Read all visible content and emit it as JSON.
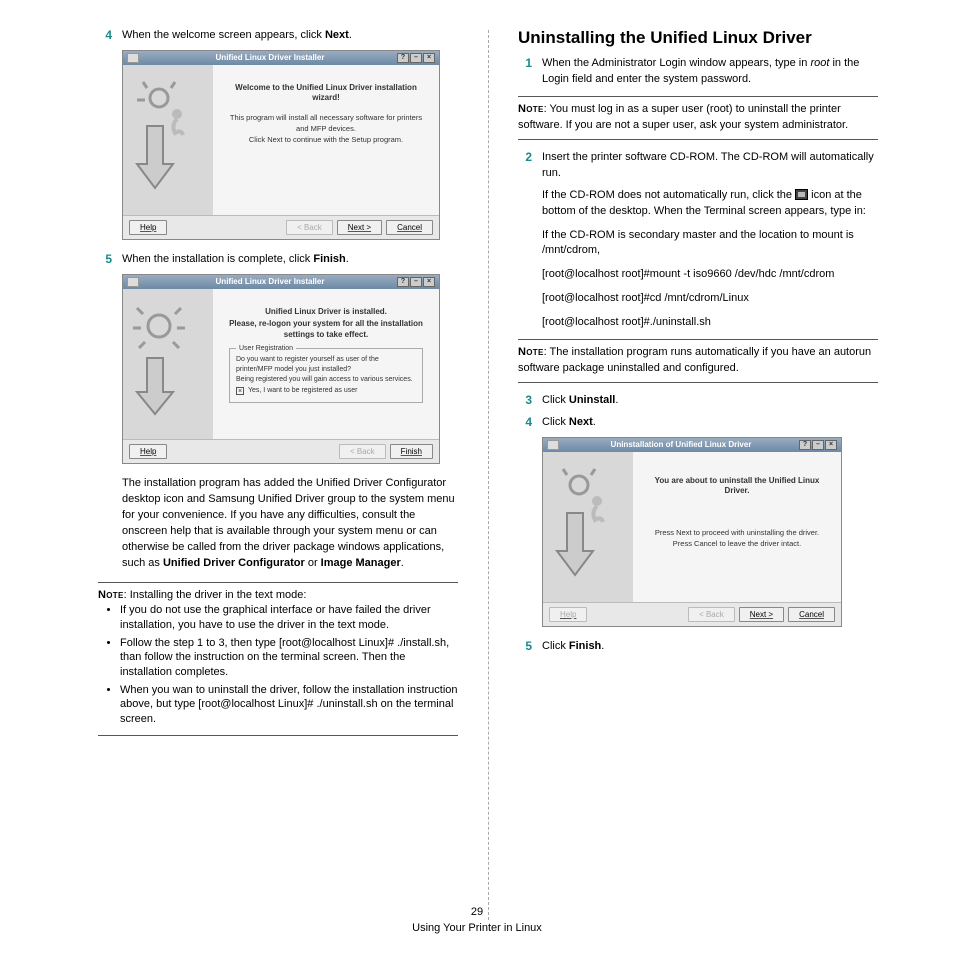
{
  "left": {
    "step4_num": "4",
    "step4_text_a": "When the welcome screen appears, click ",
    "step4_bold": "Next",
    "step4_text_b": ".",
    "step5_num": "5",
    "step5_text_a": "When the installation is complete, click ",
    "step5_bold": "Finish",
    "step5_text_b": ".",
    "para_a": "The installation program has added the Unified Driver Configurator desktop icon and Samsung Unified Driver group to the system menu for your convenience. If you have any difficulties, consult the onscreen help that is available through your system menu or can otherwise be called from the driver package windows applications, such as ",
    "para_b1": "Unified Driver Configurator",
    "para_mid": " or ",
    "para_b2": "Image Manager",
    "para_end": ".",
    "note_label": "Note",
    "note_intro": ": Installing the driver in the text mode:",
    "b1": "If you do not use the graphical interface or have failed the driver installation, you have to use the driver in the text mode.",
    "b2": "Follow the step 1 to 3, then type [root@localhost Linux]# ./install.sh, than follow the instruction on the terminal screen. Then the installation completes.",
    "b3": "When you wan to uninstall the driver, follow the installation instruction above, but type [root@localhost Linux]# ./uninstall.sh on the terminal screen.",
    "mock1": {
      "title": "Unified Linux Driver Installer",
      "h1": "Welcome to the Unified Linux Driver installation wizard!",
      "l1": "This program will install all necessary software for printers and MFP devices.",
      "l2": "Click Next to continue with the Setup program.",
      "help": "Help",
      "back": "< Back",
      "next": "Next >",
      "cancel": "Cancel"
    },
    "mock2": {
      "title": "Unified Linux Driver Installer",
      "h1": "Unified Linux Driver is installed.",
      "h2": "Please, re-logon your system for all the installation settings to take effect.",
      "legend": "User Registration",
      "reg_q": "Do you want to register yourself as user of the printer/MFP model you just installed?",
      "reg_r": "Being registered you will gain access to various services.",
      "cb": "Yes, I want to be registered as user",
      "help": "Help",
      "back": "< Back",
      "finish": "Finish"
    }
  },
  "right": {
    "heading": "Uninstalling the Unified Linux Driver",
    "s1_num": "1",
    "s1_a": "When the Administrator Login window appears, type in ",
    "s1_i": "root",
    "s1_b": " in the Login field and enter the system password.",
    "note1_label": "Note",
    "note1_text": ": You must log in as a super user (root) to uninstall the printer software. If you are not a super user, ask your system administrator.",
    "s2_num": "2",
    "s2_text": "Insert the printer software CD-ROM. The CD-ROM will automatically run.",
    "i1a": "If the CD-ROM does not automatically run, click the ",
    "i1b": " icon at the bottom of the desktop. When the Terminal screen appears, type in:",
    "i2": "If the CD-ROM is secondary master and the location to mount is /mnt/cdrom,",
    "i3": "[root@localhost root]#mount -t iso9660 /dev/hdc /mnt/cdrom",
    "i4": "[root@localhost root]#cd /mnt/cdrom/Linux",
    "i5": "[root@localhost root]#./uninstall.sh",
    "note2_label": "Note",
    "note2_text": ": The installation program runs automatically if you have an autorun software package uninstalled and configured.",
    "s3_num": "3",
    "s3_a": "Click ",
    "s3_b": "Uninstall",
    "s3_c": ".",
    "s4_num": "4",
    "s4_a": "Click ",
    "s4_b": "Next",
    "s4_c": ".",
    "s5_num": "5",
    "s5_a": "Click ",
    "s5_b": "Finish",
    "s5_c": ".",
    "mock": {
      "title": "Uninstallation of Unified Linux Driver",
      "h1": "You are about to uninstall the Unified Linux Driver.",
      "l1": "Press Next to proceed with uninstalling the driver.",
      "l2": "Press Cancel to leave the driver intact.",
      "help": "Help",
      "back": "< Back",
      "next": "Next >",
      "cancel": "Cancel"
    }
  },
  "footer": {
    "page": "29",
    "section": "Using Your Printer in Linux"
  }
}
